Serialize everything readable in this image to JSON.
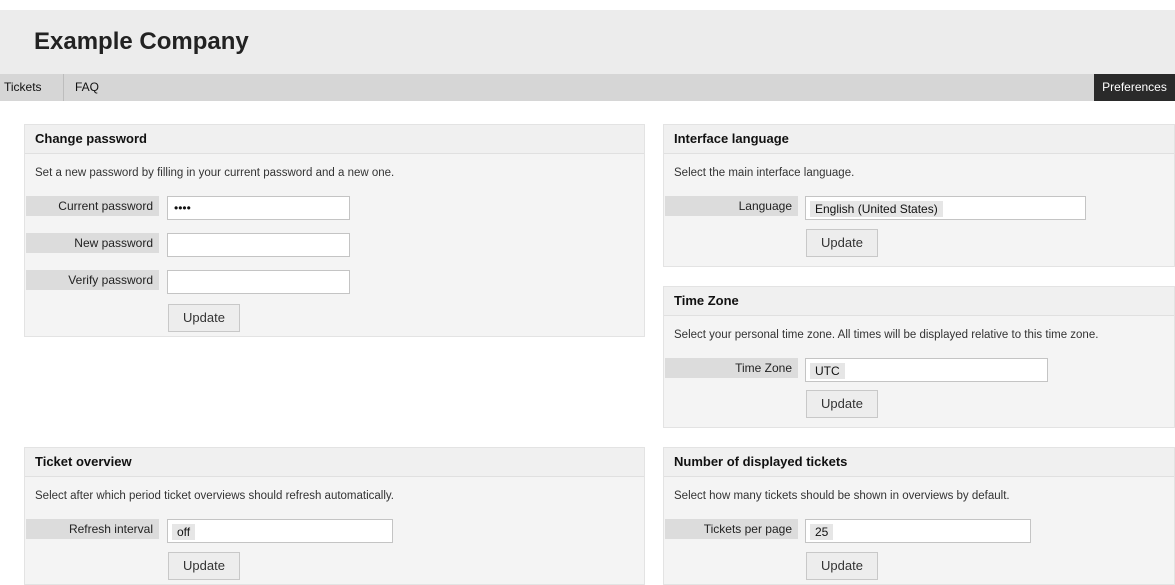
{
  "header": {
    "company": "Example Company"
  },
  "nav": {
    "items": [
      {
        "label": "Tickets"
      },
      {
        "label": "FAQ"
      }
    ],
    "preferences": "Preferences"
  },
  "change_password": {
    "title": "Change password",
    "description": "Set a new password by filling in your current password and a new one.",
    "current_label": "Current password",
    "current_value": "••••",
    "new_label": "New password",
    "new_value": "",
    "verify_label": "Verify password",
    "verify_value": "",
    "button": "Update"
  },
  "interface_language": {
    "title": "Interface language",
    "description": "Select the main interface language.",
    "label": "Language",
    "value": "English (United States)",
    "button": "Update"
  },
  "time_zone": {
    "title": "Time Zone",
    "description": "Select your personal time zone. All times will be displayed relative to this time zone.",
    "label": "Time Zone",
    "value": "UTC",
    "button": "Update"
  },
  "ticket_overview": {
    "title": "Ticket overview",
    "description": "Select after which period ticket overviews should refresh automatically.",
    "label": "Refresh interval",
    "value": "off",
    "button": "Update"
  },
  "displayed_tickets": {
    "title": "Number of displayed tickets",
    "description": "Select how many tickets should be shown in overviews by default.",
    "label": "Tickets per page",
    "value": "25",
    "button": "Update"
  }
}
